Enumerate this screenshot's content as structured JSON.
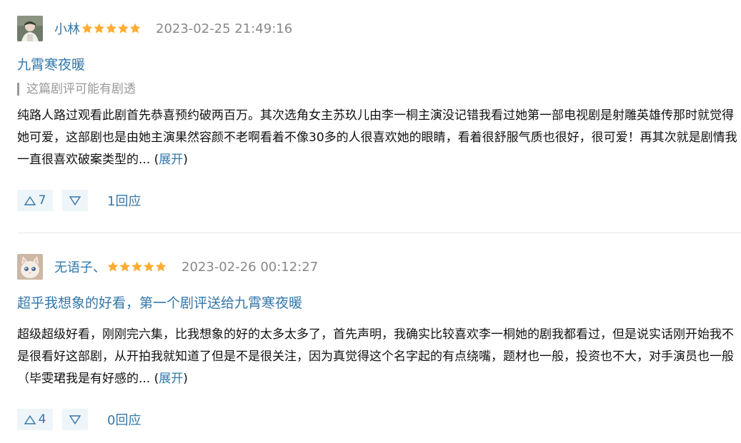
{
  "reviews": [
    {
      "username": "小林",
      "rating_stars": 5,
      "time": "2023-02-25 21:49:16",
      "title": "九霄寒夜暖",
      "spoiler_note": "这篇剧评可能有剧透",
      "body": "纯路人路过观看此剧首先恭喜预约破两百万。其次选角女主苏玖儿由李一桐主演没记错我看过她第一部电视剧是射雕英雄传那时就觉得她可爱，这部剧也是由她主演果然容颜不老啊看着不像30多的人很喜欢她的眼睛，看着很舒服气质也很好，很可爱！再其次就是剧情我一直很喜欢破案类型的... ",
      "expand_open": "(",
      "expand_label": "展开",
      "expand_close": ")",
      "upvotes": "7",
      "replies": "1回应",
      "avatar_icon": "avatar-photo-icon"
    },
    {
      "username": "无语子、",
      "rating_stars": 5,
      "time": "2023-02-26 00:12:27",
      "title": "超乎我想象的好看，第一个剧评送给九霄寒夜暖",
      "body": "超级超级好看，刚刚完六集，比我想象的好的太多太多了，首先声明，我确实比较喜欢李一桐她的剧我都看过，但是说实话刚开始我不是很看好这部剧，从开拍我就知道了但是不是很关注，因为真觉得这个名字起的有点绕嘴，题材也一般，投资也不大，对手演员也一般（毕雯珺我是有好感的... ",
      "expand_open": "(",
      "expand_label": "展开",
      "expand_close": ")",
      "upvotes": "4",
      "replies": "0回应",
      "avatar_icon": "avatar-cat-icon"
    }
  ],
  "colors": {
    "link": "#3377aa",
    "time": "#888888",
    "star": "#ffad33",
    "vote_bg": "#eef5f8"
  },
  "icons": {
    "upvote": "triangle-up-outline-icon",
    "downvote": "triangle-down-outline-icon",
    "star": "star-icon"
  }
}
